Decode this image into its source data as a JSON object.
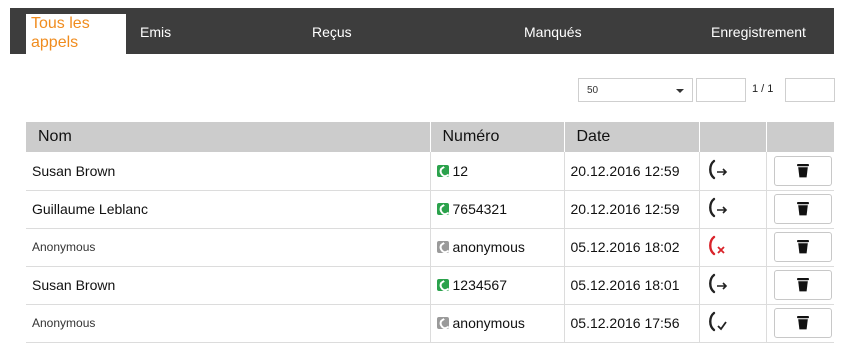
{
  "tabs": {
    "all": "Tous les appels",
    "emis": "Emis",
    "recus": "Reçus",
    "manques": "Manqués",
    "enregistrement": "Enregistrement"
  },
  "pager": {
    "per_page": "50",
    "page_from": "",
    "page_info": "1 / 1",
    "page_to": ""
  },
  "table": {
    "headers": {
      "name": "Nom",
      "number": "Numéro",
      "date": "Date"
    },
    "rows": [
      {
        "name": "Susan Brown",
        "number": "12",
        "date": "20.12.2016 12:59",
        "type": "outgoing",
        "number_icon": "phone-book-icon"
      },
      {
        "name": "Guillaume Leblanc",
        "number": "7654321",
        "date": "20.12.2016 12:59",
        "type": "outgoing",
        "number_icon": "phone-book-icon"
      },
      {
        "name": "Anonymous",
        "number": "anonymous",
        "date": "05.12.2016 18:02",
        "type": "missed",
        "number_icon": "phone-grey-icon"
      },
      {
        "name": "Susan Brown",
        "number": "1234567",
        "date": "05.12.2016 18:01",
        "type": "outgoing",
        "number_icon": "phone-book-icon"
      },
      {
        "name": "Anonymous",
        "number": "anonymous",
        "date": "05.12.2016 17:56",
        "type": "received",
        "number_icon": "phone-grey-icon"
      }
    ]
  },
  "colors": {
    "active_tab_text": "#f08c1e",
    "tab_bar": "#3d3d3d",
    "header_bg": "#cccccc",
    "missed": "#d9232a",
    "phone_green": "#2ba24c"
  }
}
